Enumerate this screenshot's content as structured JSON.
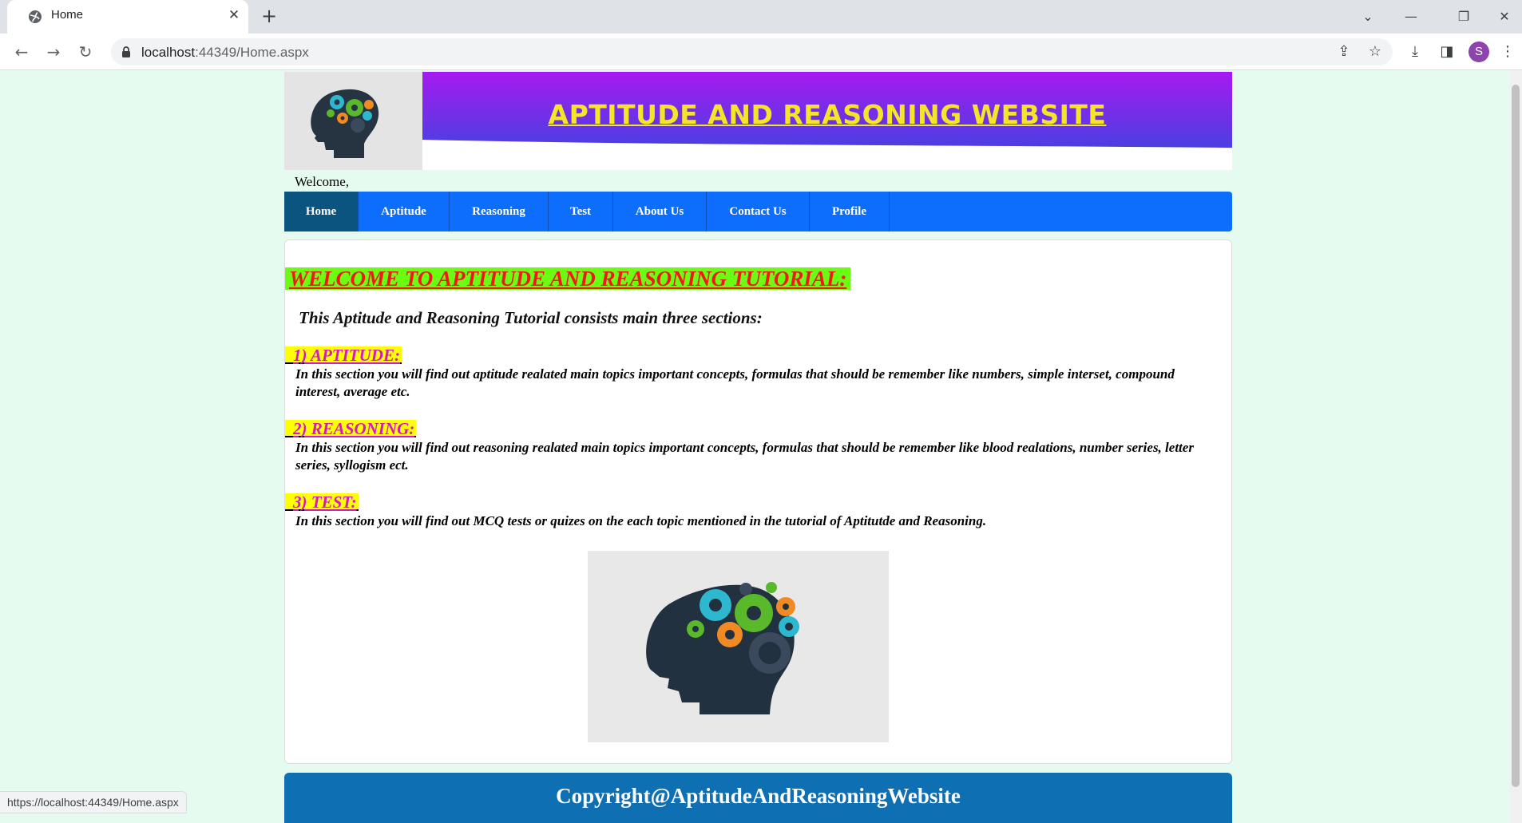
{
  "browser": {
    "tab_title": "Home",
    "tab_close": "✕",
    "new_tab": "+",
    "url_host": "localhost",
    "url_path": ":44349/Home.aspx",
    "profile_initial": "S",
    "status_url": "https://localhost:44349/Home.aspx",
    "controls": {
      "tab_search": "⌄",
      "minimize": "—",
      "restore": "❐",
      "close": "✕",
      "back": "←",
      "forward": "→",
      "reload": "↻",
      "share": "⇪",
      "bookmark": "☆",
      "download": "⤓",
      "side_panel": "◨",
      "menu": "⋮"
    }
  },
  "banner": {
    "title": "APTITUDE AND REASONING WEBSITE"
  },
  "welcome_text": "Welcome,",
  "nav": {
    "items": [
      {
        "label": "Home",
        "active": true
      },
      {
        "label": "Aptitude"
      },
      {
        "label": "Reasoning"
      },
      {
        "label": "Test"
      },
      {
        "label": "About Us"
      },
      {
        "label": "Contact Us"
      },
      {
        "label": "Profile"
      }
    ]
  },
  "content": {
    "heading": "WELCOME TO APTITUDE AND REASONING TUTORIAL:",
    "intro": "This Aptitude and Reasoning Tutorial consists main three sections:",
    "sections": [
      {
        "title": "1) APTITUDE:",
        "description": "In this section you will find out aptitude realated main topics important concepts, formulas that should be remember like numbers, simple interset, compound interest, average etc."
      },
      {
        "title": "2) REASONING:",
        "description": "In this section you will find out reasoning realated main topics important concepts, formulas that should be remember like blood realations, number series, letter series, syllogism ect."
      },
      {
        "title": "3) TEST:",
        "description": "In this section you will find out MCQ tests or quizes on the each topic mentioned in the tutorial of Aptitutde and Reasoning."
      }
    ]
  },
  "footer": {
    "text": "Copyright@AptitudeAndReasoningWebsite"
  },
  "colors": {
    "page_bg": "#e6fbef",
    "nav_bg": "#0d6efd",
    "nav_active": "#0b5480",
    "heading_bg": "#6cfc13",
    "heading_text": "#f21818",
    "section_bg": "#ffff00",
    "section_text": "#d418c9",
    "banner_title": "#f5e52a",
    "footer_bg": "#0e6fb3"
  }
}
